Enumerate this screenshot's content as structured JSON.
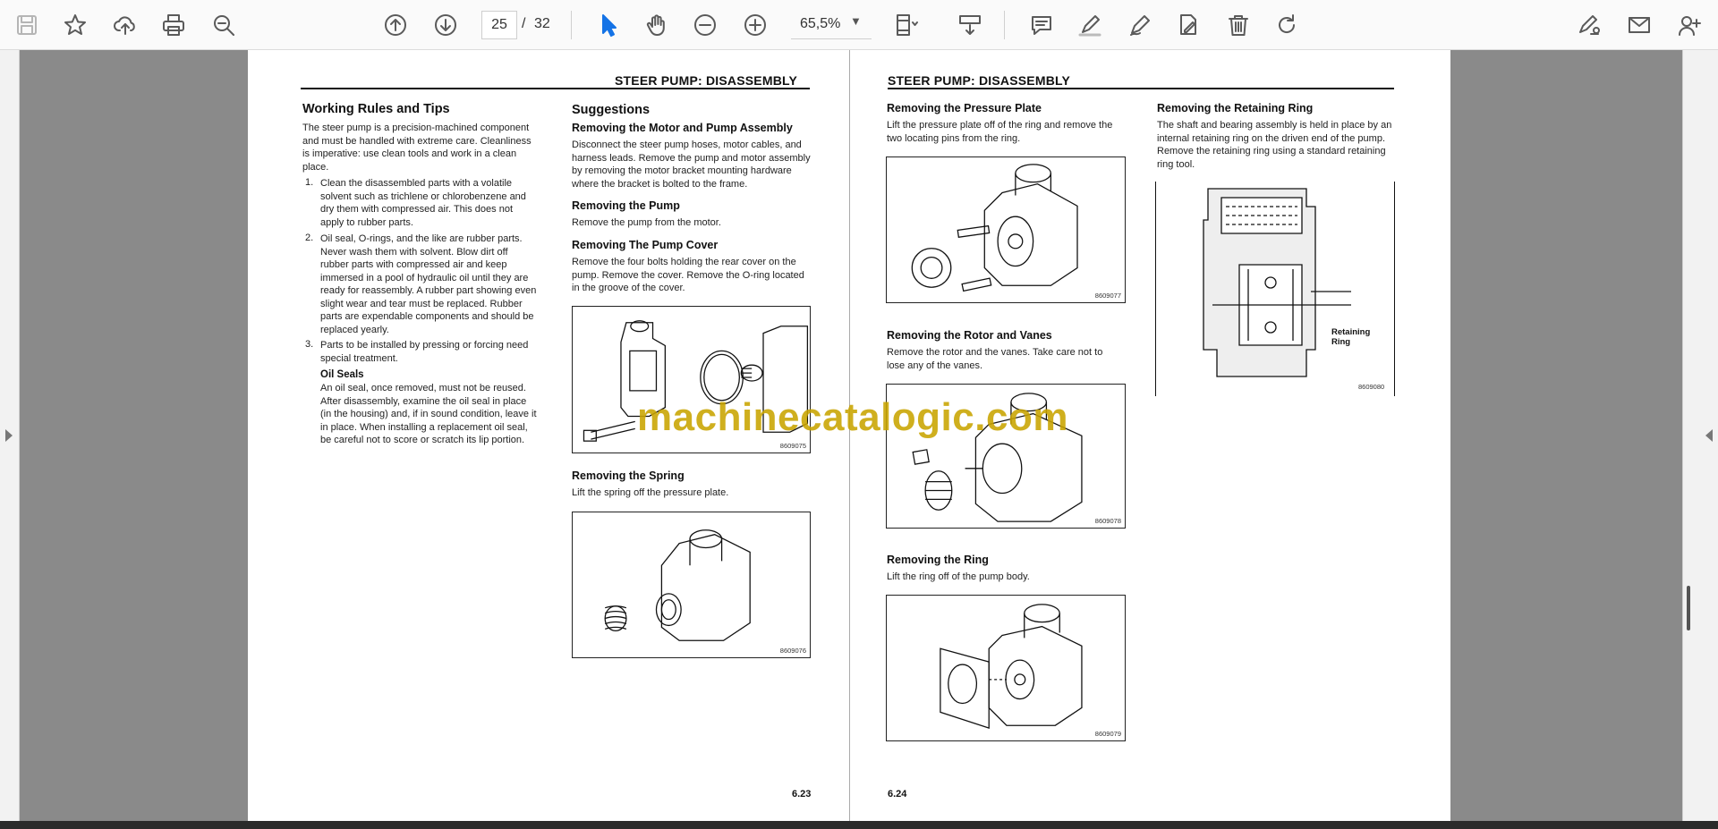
{
  "toolbar": {
    "current_page": "25",
    "page_separator": "/",
    "total_pages": "32",
    "zoom": "65,5%"
  },
  "watermark": "machinecatalogic.com",
  "left_page": {
    "header": "STEER PUMP: DISASSEMBLY",
    "page_number": "6.23",
    "working_rules": {
      "title": "Working Rules and Tips",
      "intro": "The steer pump is a precision-machined component and must be handled with extreme care. Cleanliness is imperative: use clean tools and work in a clean place.",
      "items": [
        {
          "num": "1.",
          "text": "Clean the disassembled parts with a volatile solvent such as trichlene or chlorobenzene and dry them with compressed air. This does not apply to rubber parts."
        },
        {
          "num": "2.",
          "text": "Oil seal, O-rings, and the like are rubber parts. Never wash them with solvent. Blow dirt off rubber parts with compressed air and keep immersed in a pool of hydraulic oil until they are ready for reassembly. A rubber part showing even slight wear and tear must be replaced. Rubber parts are expendable components and should be replaced yearly."
        },
        {
          "num": "3.",
          "text": "Parts to be installed by pressing or forcing need special treatment."
        }
      ],
      "oil_seals_title": "Oil Seals",
      "oil_seals_text": "An oil seal, once removed, must not be reused. After disassembly, examine the oil seal in place (in the housing) and, if in sound condition, leave it in place. When installing a replacement oil seal, be careful not to score or scratch its lip portion."
    },
    "suggestions": {
      "title": "Suggestions",
      "motor_title": "Removing the Motor and Pump Assembly",
      "motor_text": "Disconnect the steer pump hoses, motor cables, and harness leads. Remove the pump and motor assembly by removing the motor bracket mounting hardware where the bracket is bolted to the frame.",
      "pump_title": "Removing the Pump",
      "pump_text": "Remove the pump from the motor.",
      "cover_title": "Removing The Pump Cover",
      "cover_text": "Remove the four bolts holding the rear cover on the pump. Remove the cover. Remove the O-ring located in the groove of the cover.",
      "fig1_code": "8609075",
      "spring_title": "Removing the Spring",
      "spring_text": "Lift the spring off the pressure plate.",
      "fig2_code": "8609076"
    }
  },
  "right_page": {
    "header": "STEER PUMP: DISASSEMBLY",
    "page_number": "6.24",
    "pressure_title": "Removing the Pressure Plate",
    "pressure_text": "Lift the pressure plate off of the ring and remove the two locating pins from the ring.",
    "fig3_code": "8609077",
    "rotor_title": "Removing the Rotor and Vanes",
    "rotor_text": "Remove the rotor and the vanes. Take care not to lose any of the vanes.",
    "fig4_code": "8609078",
    "ring_title": "Removing the Ring",
    "ring_text": "Lift the ring off of the pump body.",
    "fig5_code": "8609079",
    "retaining_title": "Removing the Retaining Ring",
    "retaining_text": "The shaft and bearing assembly is held in place by an internal retaining ring on the driven end of the pump. Remove the retaining ring using a standard retaining ring tool.",
    "fig6_label_line1": "Retaining",
    "fig6_label_line2": "Ring",
    "fig6_code": "8609080"
  }
}
